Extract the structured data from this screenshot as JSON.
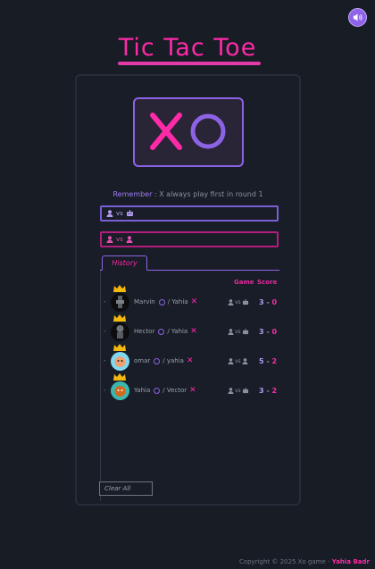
{
  "header": {
    "title": "Tic Tac Toe",
    "sound_icon": "speaker-icon"
  },
  "logo": {
    "x": "X",
    "o": "O"
  },
  "remember": {
    "label": "Remember :",
    "text": "X always play first in round 1"
  },
  "modes": [
    {
      "name": "player-vs-bot",
      "vs": "vs",
      "icons": [
        "user-icon",
        "robot-icon"
      ]
    },
    {
      "name": "player-vs-player",
      "vs": "vs",
      "icons": [
        "user-icon",
        "user-icon"
      ]
    }
  ],
  "history": {
    "tab_label": "History",
    "col_game": "Game",
    "col_score": "Score",
    "rows": [
      {
        "winner": "Marvin",
        "opponent": "/ Yahia",
        "mode": "bot",
        "score_a": "3",
        "score_b": "0"
      },
      {
        "winner": "Hector",
        "opponent": "/ Yahia",
        "mode": "bot",
        "score_a": "3",
        "score_b": "0"
      },
      {
        "winner": "omar",
        "opponent": "/ yahia",
        "mode": "pvp",
        "score_a": "5",
        "score_b": "2"
      },
      {
        "winner": "Yahia",
        "opponent": "/ Vector",
        "mode": "bot",
        "score_a": "3",
        "score_b": "2"
      }
    ],
    "vs": "vs",
    "dash": "-"
  },
  "clear_label": "Clear All",
  "footer": {
    "text": "Copyright © 2025 Xo game -",
    "author": "Yahia Badr"
  },
  "colors": {
    "background": "#171c25",
    "pink": "#ff2aa8",
    "purple": "#8d63e6"
  }
}
